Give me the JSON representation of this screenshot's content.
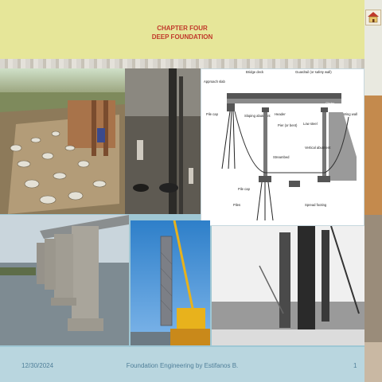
{
  "slide": {
    "title_line1": "CHAPTER FOUR",
    "title_line2": "DEEP FOUNDATION",
    "footer_date": "12/30/2024",
    "footer_text": "Foundation Engineering by Estifanos B.",
    "slide_number": "1",
    "home_icon": "home-icon"
  },
  "diagram": {
    "labels": {
      "bridge_deck": "Bridge deck",
      "guardrail": "Guardrail (or safety wall)",
      "approach_slab": "Approach slab",
      "girder": "Girder",
      "pile_cap_left": "Pile cap",
      "sloping_abutment": "Sloping abutment",
      "header": "Header",
      "pier": "Pier (or bent)",
      "low_steel": "Low steel",
      "wing_wall": "Wing wall",
      "streambed": "Streambed",
      "vertical_abutment": "Vertical abutment",
      "pile_cap_bottom": "Pile cap",
      "piles": "Piles",
      "spread_footing": "Spread footing"
    }
  },
  "colors": {
    "title_red": "#c0392b",
    "footer_text": "#4f7f99",
    "title_band": "#e6e699"
  }
}
